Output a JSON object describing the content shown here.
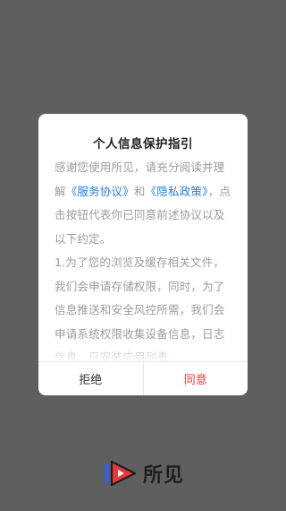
{
  "dialog": {
    "title": "个人信息保护指引",
    "para1_before": "感谢您使用所见，请充分阅读并理解",
    "link_service": "《服务协议》",
    "para1_and": "和",
    "link_privacy": "《隐私政策》",
    "para1_after": "，点击按钮代表你已同意前述协议以及以下约定。",
    "para2": "1.为了您的浏览及缓存相关文件，我们会申请存储权限，同时，为了信息推送和安全风控所需，我们会申请系统权限收集设备信息，日志信息、已安装应用列表。",
    "reject_label": "拒绝",
    "agree_label": "同意"
  },
  "brand": {
    "name": "所见",
    "colors": {
      "blue": "#3b5bd9",
      "red": "#e23b3b",
      "dark": "#1f1f1f"
    }
  },
  "colors": {
    "overlay": "#5f5f5f",
    "link": "#2a7fd6",
    "agree": "#e23b3b",
    "body_text": "#9c9c9c"
  }
}
